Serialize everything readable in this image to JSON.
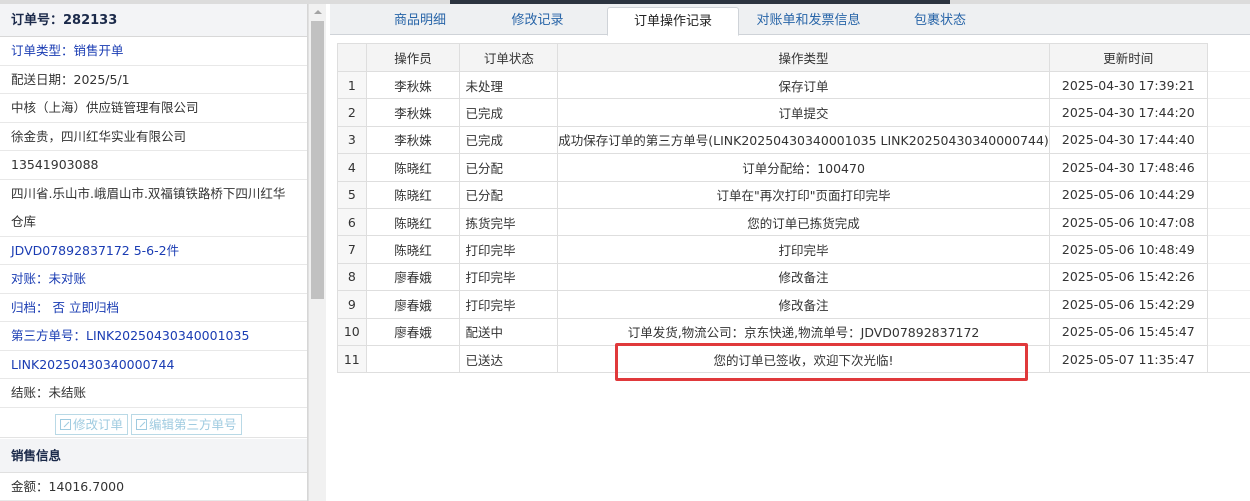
{
  "order": {
    "header": "订单号：282133",
    "type": "订单类型：销售开单",
    "delivery_date": "配送日期：2025/5/1",
    "company": "中核（上海）供应链管理有限公司",
    "customer": "徐金贵，四川红华实业有限公司",
    "phone": "13541903088",
    "address": "四川省.乐山市.峨眉山市.双福镇铁路桥下四川红华仓库",
    "tracking": "JDVD07892837172 5-6-2件",
    "reconcile": "对账：未对账",
    "archive": "归档：  否 立即归档",
    "third_party_1": "第三方单号：LINK20250430340001035",
    "third_party_2": "LINK20250430340000744",
    "settlement": "结账：未结账",
    "btn_edit_order": "修改订单",
    "btn_edit_third": "编辑第三方单号"
  },
  "sales": {
    "header": "销售信息",
    "amount": "金额：14016.7000"
  },
  "tabs": [
    "商品明细",
    "修改记录",
    "订单操作记录",
    "对账单和发票信息",
    "包裹状态"
  ],
  "table": {
    "columns": [
      "",
      "操作员",
      "订单状态",
      "操作类型",
      "更新时间"
    ],
    "rows": [
      {
        "no": "1",
        "operator": "李秋姝",
        "status": "未处理",
        "action": "保存订单",
        "time": "2025-04-30 17:39:21"
      },
      {
        "no": "2",
        "operator": "李秋姝",
        "status": "已完成",
        "action": "订单提交",
        "time": "2025-04-30 17:44:20"
      },
      {
        "no": "3",
        "operator": "李秋姝",
        "status": "已完成",
        "action": "成功保存订单的第三方单号(LINK20250430340001035 LINK20250430340000744)",
        "time": "2025-04-30 17:44:40"
      },
      {
        "no": "4",
        "operator": "陈晓红",
        "status": "已分配",
        "action": "订单分配给：100470",
        "time": "2025-04-30 17:48:46"
      },
      {
        "no": "5",
        "operator": "陈晓红",
        "status": "已分配",
        "action": "订单在\"再次打印\"页面打印完毕",
        "time": "2025-05-06 10:44:29"
      },
      {
        "no": "6",
        "operator": "陈晓红",
        "status": "拣货完毕",
        "action": "您的订单已拣货完成",
        "time": "2025-05-06 10:47:08"
      },
      {
        "no": "7",
        "operator": "陈晓红",
        "status": "打印完毕",
        "action": "打印完毕",
        "time": "2025-05-06 10:48:49"
      },
      {
        "no": "8",
        "operator": "廖春娥",
        "status": "打印完毕",
        "action": "修改备注",
        "time": "2025-05-06 15:42:26"
      },
      {
        "no": "9",
        "operator": "廖春娥",
        "status": "打印完毕",
        "action": "修改备注",
        "time": "2025-05-06 15:42:29"
      },
      {
        "no": "10",
        "operator": "廖春娥",
        "status": "配送中",
        "action": "订单发货,物流公司：京东快递,物流单号：JDVD07892837172",
        "time": "2025-05-06 15:45:47"
      },
      {
        "no": "11",
        "operator": "",
        "status": "已送达",
        "action": "您的订单已签收，欢迎下次光临!",
        "time": "2025-05-07 11:35:47"
      }
    ]
  },
  "colors": {
    "highlight": "#e0393b",
    "link_blue": "#1a3cb3",
    "tab_blue": "#2865a8"
  }
}
